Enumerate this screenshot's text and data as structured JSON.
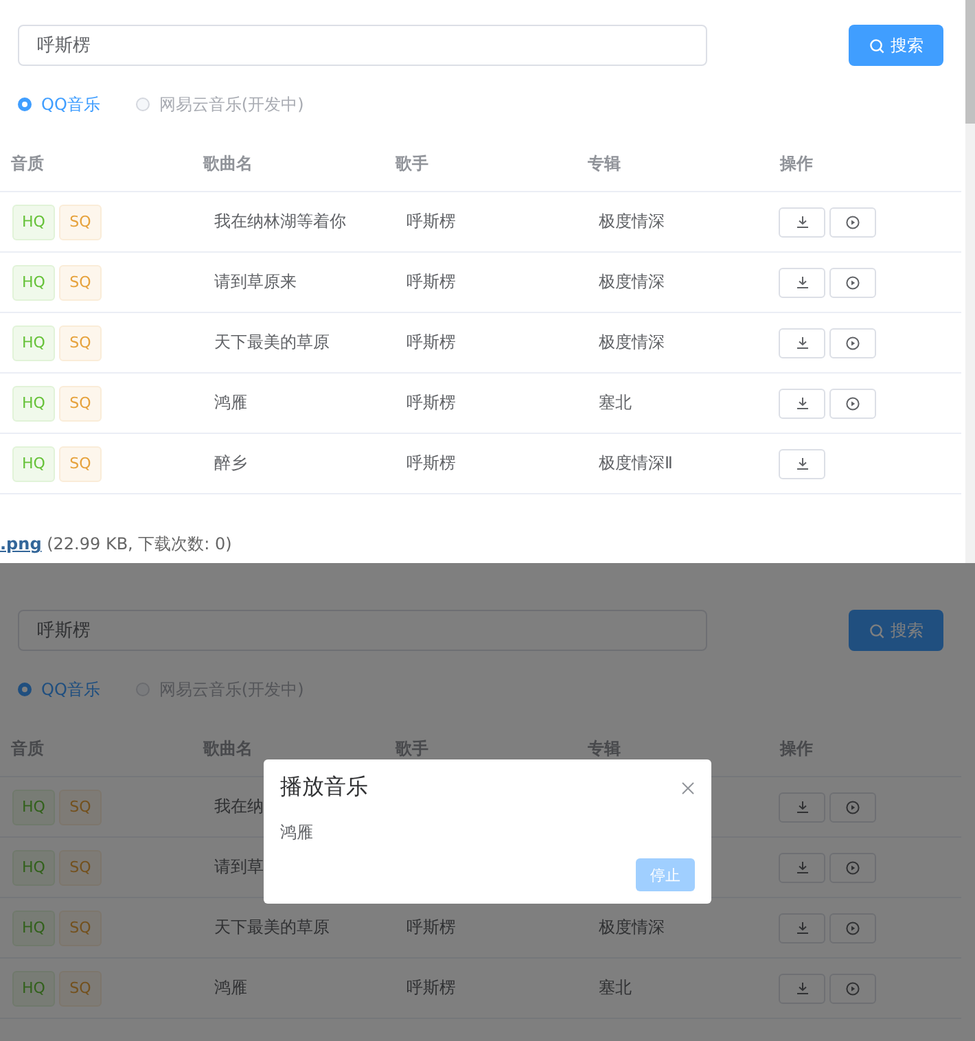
{
  "screens": [
    {
      "scrollbar": true,
      "search": {
        "value": "呼斯楞",
        "button": "搜索"
      },
      "radios": [
        {
          "label": "QQ音乐",
          "selected": true,
          "disabled": false
        },
        {
          "label": "网易云音乐(开发中)",
          "selected": false,
          "disabled": true
        }
      ],
      "columns": [
        "音质",
        "歌曲名",
        "歌手",
        "专辑",
        "操作"
      ],
      "rows": [
        {
          "tags": [
            {
              "label": "HQ",
              "kind": "success"
            },
            {
              "label": "SQ",
              "kind": "warning"
            }
          ],
          "song": "我在纳林湖等着你",
          "singer": "呼斯楞",
          "album": "极度情深",
          "actions": [
            {
              "kind": "download"
            },
            {
              "kind": "play"
            }
          ]
        },
        {
          "tags": [
            {
              "label": "HQ",
              "kind": "success"
            },
            {
              "label": "SQ",
              "kind": "warning"
            }
          ],
          "song": "请到草原来",
          "singer": "呼斯楞",
          "album": "极度情深",
          "actions": [
            {
              "kind": "download"
            },
            {
              "kind": "play"
            }
          ]
        },
        {
          "tags": [
            {
              "label": "HQ",
              "kind": "success"
            },
            {
              "label": "SQ",
              "kind": "warning"
            }
          ],
          "song": "天下最美的草原",
          "singer": "呼斯楞",
          "album": "极度情深",
          "actions": [
            {
              "kind": "download"
            },
            {
              "kind": "play"
            }
          ]
        },
        {
          "tags": [
            {
              "label": "HQ",
              "kind": "success"
            },
            {
              "label": "SQ",
              "kind": "warning"
            }
          ],
          "song": "鸿雁",
          "singer": "呼斯楞",
          "album": "塞北",
          "actions": [
            {
              "kind": "download"
            },
            {
              "kind": "play"
            }
          ]
        },
        {
          "tags": [
            {
              "label": "HQ",
              "kind": "success"
            },
            {
              "label": "SQ",
              "kind": "warning"
            }
          ],
          "song": "醉乡",
          "singer": "呼斯楞",
          "album": "极度情深Ⅱ",
          "actions": [
            {
              "kind": "download"
            }
          ]
        }
      ],
      "attachment": {
        "link": ".png",
        "info": "(22.99 KB, 下载次数: 0)"
      }
    },
    {
      "dimmed": true,
      "search": {
        "value": "呼斯楞",
        "button": "搜索"
      },
      "radios": [
        {
          "label": "QQ音乐",
          "selected": true,
          "disabled": false
        },
        {
          "label": "网易云音乐(开发中)",
          "selected": false,
          "disabled": true
        }
      ],
      "columns": [
        "音质",
        "歌曲名",
        "歌手",
        "专辑",
        "操作"
      ],
      "rows": [
        {
          "tags": [
            {
              "label": "HQ",
              "kind": "success"
            },
            {
              "label": "SQ",
              "kind": "warning"
            }
          ],
          "song": "我在纳",
          "actions": [
            {
              "kind": "download"
            },
            {
              "kind": "play"
            }
          ]
        },
        {
          "tags": [
            {
              "label": "HQ",
              "kind": "success"
            },
            {
              "label": "SQ",
              "kind": "warning"
            }
          ],
          "song": "请到草",
          "actions": [
            {
              "kind": "download"
            },
            {
              "kind": "play"
            }
          ]
        },
        {
          "tags": [
            {
              "label": "HQ",
              "kind": "success"
            },
            {
              "label": "SQ",
              "kind": "warning"
            }
          ],
          "song": "天下最美的草原",
          "singer": "呼斯楞",
          "album": "极度情深",
          "actions": [
            {
              "kind": "download"
            },
            {
              "kind": "play"
            }
          ]
        },
        {
          "tags": [
            {
              "label": "HQ",
              "kind": "success"
            },
            {
              "label": "SQ",
              "kind": "warning"
            }
          ],
          "song": "鸿雁",
          "singer": "呼斯楞",
          "album": "塞北",
          "actions": [
            {
              "kind": "download"
            },
            {
              "kind": "play"
            }
          ]
        }
      ],
      "dialog": {
        "title": "播放音乐",
        "body": "鸿雁",
        "button": "停止"
      }
    }
  ]
}
